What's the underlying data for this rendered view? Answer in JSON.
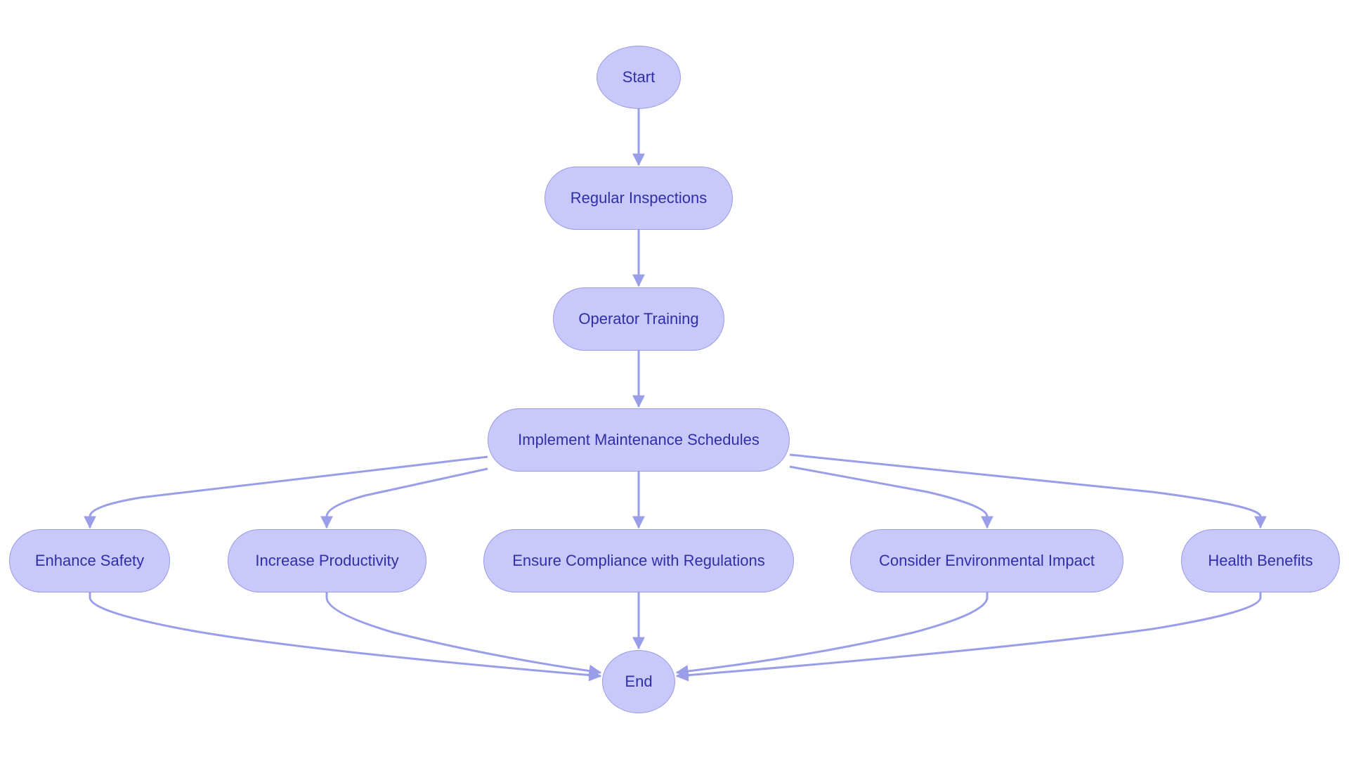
{
  "diagram": {
    "type": "flowchart",
    "colors": {
      "node_fill": "#c8c8fb",
      "node_stroke": "#9a9ae6",
      "node_text": "#2f2fa9",
      "edge": "#9a9ee8"
    },
    "nodes": {
      "start": {
        "label": "Start",
        "shape": "circle"
      },
      "regular_inspections": {
        "label": "Regular Inspections",
        "shape": "rounded"
      },
      "operator_training": {
        "label": "Operator Training",
        "shape": "rounded"
      },
      "implement_maintenance": {
        "label": "Implement Maintenance Schedules",
        "shape": "rounded"
      },
      "enhance_safety": {
        "label": "Enhance Safety",
        "shape": "rounded"
      },
      "increase_productivity": {
        "label": "Increase Productivity",
        "shape": "rounded"
      },
      "ensure_compliance": {
        "label": "Ensure Compliance with Regulations",
        "shape": "rounded"
      },
      "environmental_impact": {
        "label": "Consider Environmental Impact",
        "shape": "rounded"
      },
      "health_benefits": {
        "label": "Health Benefits",
        "shape": "rounded"
      },
      "end": {
        "label": "End",
        "shape": "circle"
      }
    },
    "edges": [
      {
        "from": "start",
        "to": "regular_inspections"
      },
      {
        "from": "regular_inspections",
        "to": "operator_training"
      },
      {
        "from": "operator_training",
        "to": "implement_maintenance"
      },
      {
        "from": "implement_maintenance",
        "to": "enhance_safety"
      },
      {
        "from": "implement_maintenance",
        "to": "increase_productivity"
      },
      {
        "from": "implement_maintenance",
        "to": "ensure_compliance"
      },
      {
        "from": "implement_maintenance",
        "to": "environmental_impact"
      },
      {
        "from": "implement_maintenance",
        "to": "health_benefits"
      },
      {
        "from": "enhance_safety",
        "to": "end"
      },
      {
        "from": "increase_productivity",
        "to": "end"
      },
      {
        "from": "ensure_compliance",
        "to": "end"
      },
      {
        "from": "environmental_impact",
        "to": "end"
      },
      {
        "from": "health_benefits",
        "to": "end"
      }
    ]
  }
}
